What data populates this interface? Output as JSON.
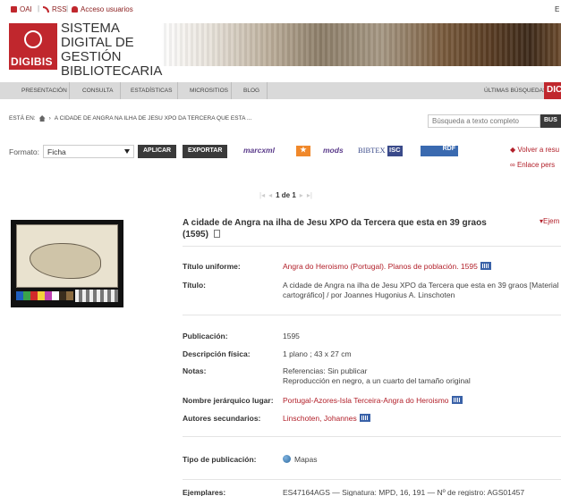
{
  "topbar": {
    "oai": "OAI",
    "rss": "RSS",
    "access": "Acceso usuarios",
    "right_letter": "E"
  },
  "header": {
    "logo_text": "DIGIBIS",
    "title": "SISTEMA DIGITAL DE GESTIÓN BIBLIOTECARIA"
  },
  "nav": {
    "items": [
      "PRESENTACIÓN",
      "CONSULTA",
      "ESTADÍSTICAS",
      "MICROSITIOS",
      "BLOG"
    ],
    "right_item": "ÚLTIMAS BÚSQUEDAS",
    "right_tab": "DIC"
  },
  "breadcrumb": {
    "prefix": "ESTÁ EN:",
    "current": "A CIDADE DE ANGRA NA ILHA DE JESU XPO DA TERCERA QUE ESTA ..."
  },
  "search": {
    "placeholder": "Búsqueda a texto completo",
    "button": "BUS"
  },
  "format": {
    "label": "Formato:",
    "selected": "Ficha",
    "apply": "APLICAR",
    "export": "EXPORTAR",
    "formats": [
      "marcxml",
      "★",
      "mods",
      "BIBTEX",
      "ISC",
      "RDF"
    ]
  },
  "links": {
    "back": "Volver a resu",
    "permalink": "Enlace pers"
  },
  "pagination": {
    "current": "1 de 1"
  },
  "record": {
    "title": "A cidade de Angra na ilha de Jesu XPO da Tercera que esta en 39 graos (1595)",
    "ejemplares_link": "Ejem",
    "fields": [
      {
        "label": "Título uniforme:",
        "value": "Angra do Heroismo (Portugal). Planos de población. 1595"
      },
      {
        "label": "Título:",
        "value": "A cidade de Angra na ilha de Jesu XPO da Tercera que esta en 39 graos [Material",
        "value2": "cartográfico] / por Joannes Hugonius A. Linschoten"
      },
      {
        "label": "Publicación:",
        "value": "1595"
      },
      {
        "label": "Descripción física:",
        "value": "1 plano ; 43 x 27 cm"
      },
      {
        "label": "Notas:",
        "value": "Referencias: Sin publicar",
        "value2": "Reproducción en negro, a un cuarto del tamaño original"
      },
      {
        "label": "Nombre jerárquico lugar:",
        "value": "Portugal-Azores-Isla Terceira-Angra do Heroismo"
      },
      {
        "label": "Autores secundarios:",
        "value": "Linschoten, Johannes"
      },
      {
        "label": "Tipo de publicación:",
        "value": "Mapas"
      },
      {
        "label": "Ejemplares:",
        "value": "ES47164AGS — Signatura: MPD, 16, 191 — Nº de registro: AGS01457"
      }
    ]
  },
  "colors": {
    "accent": "#c0272d",
    "link": "#b2202a",
    "nav_bg": "#d9d9d9",
    "dark_button": "#3a3a3a"
  }
}
